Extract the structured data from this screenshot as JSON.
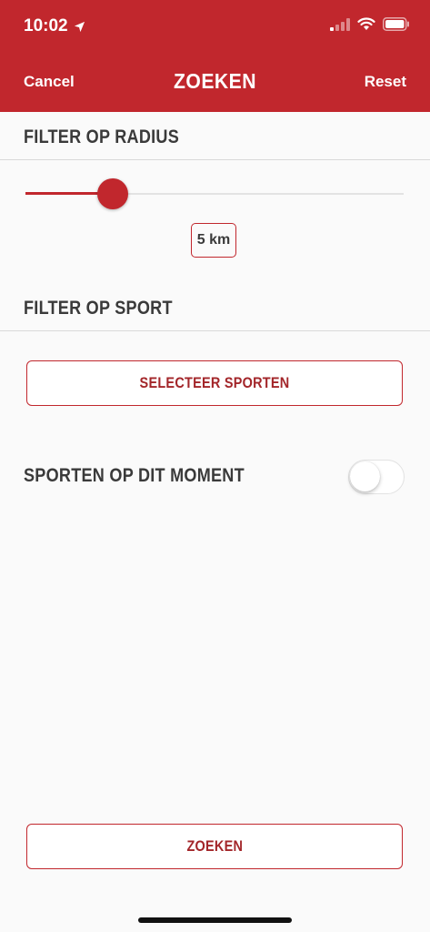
{
  "status_bar": {
    "time": "10:02"
  },
  "nav": {
    "cancel_label": "Cancel",
    "title": "ZOEKEN",
    "reset_label": "Reset"
  },
  "radius": {
    "section_title": "FILTER OP RADIUS",
    "value_label": "5 km",
    "slider_fraction": 0.23
  },
  "sport": {
    "section_title": "FILTER OP SPORT",
    "select_button_label": "SELECTEER SPORTEN"
  },
  "now": {
    "label": "SPORTEN OP DIT MOMENT",
    "toggle_on": false
  },
  "search_button_label": "ZOEKEN",
  "colors": {
    "brand": "#c1272d",
    "background": "#fafafa"
  }
}
